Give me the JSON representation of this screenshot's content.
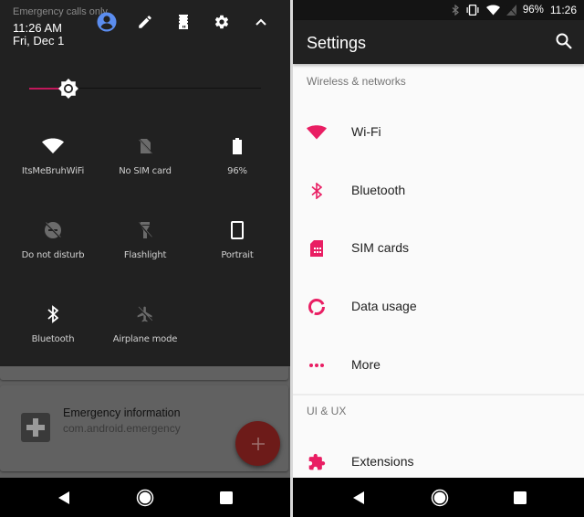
{
  "left_panel": {
    "header": {
      "carrier_status": "Emergency calls only",
      "time": "11:26 AM",
      "date": "Fri, Dec 1",
      "icons": [
        "account-icon",
        "edit-icon",
        "storage-icon",
        "settings-icon",
        "collapse-icon"
      ]
    },
    "brightness": {
      "level_fraction": 0.17,
      "accent": "#c2185b"
    },
    "tiles": [
      {
        "label": "ItsMeBruhWiFi",
        "icon": "wifi-icon",
        "active": true
      },
      {
        "label": "No SIM card",
        "icon": "no-sim-icon",
        "active": false
      },
      {
        "label": "96%",
        "icon": "battery-icon",
        "active": true
      },
      {
        "label": "Do not disturb",
        "icon": "do-not-disturb-off-icon",
        "active": false
      },
      {
        "label": "Flashlight",
        "icon": "flashlight-off-icon",
        "active": false
      },
      {
        "label": "Portrait",
        "icon": "portrait-icon",
        "active": true
      },
      {
        "label": "Bluetooth",
        "icon": "bluetooth-icon",
        "active": true
      },
      {
        "label": "Airplane mode",
        "icon": "airplane-off-icon",
        "active": false
      }
    ],
    "notification": {
      "title": "Emergency information",
      "package": "com.android.emergency"
    },
    "fab_label": "+"
  },
  "right_panel": {
    "status_bar": {
      "battery": "96%",
      "time": "11:26"
    },
    "app_bar": {
      "title": "Settings"
    },
    "sections": [
      {
        "header": "Wireless & networks",
        "items": [
          {
            "label": "Wi-Fi",
            "icon": "wifi-icon"
          },
          {
            "label": "Bluetooth",
            "icon": "bluetooth-icon"
          },
          {
            "label": "SIM cards",
            "icon": "sim-card-icon"
          },
          {
            "label": "Data usage",
            "icon": "data-usage-icon"
          },
          {
            "label": "More",
            "icon": "more-icon"
          }
        ]
      },
      {
        "header": "UI & UX",
        "items": [
          {
            "label": "Extensions",
            "icon": "extension-icon"
          }
        ]
      }
    ],
    "accent": "#e91e63"
  },
  "nav": [
    "back-button",
    "home-button",
    "recents-button"
  ]
}
